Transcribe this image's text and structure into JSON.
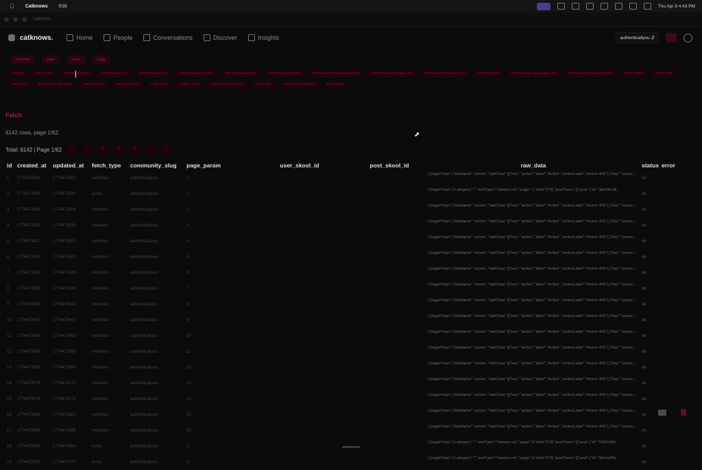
{
  "menubar": {
    "apple_icon": "apple-icon",
    "app_name": "Catknows",
    "menu": [
      "Edit"
    ],
    "clock": "Thu Apr 9 4:43 PM"
  },
  "window": {
    "title": "catknows"
  },
  "nav": {
    "brand": "catknows.",
    "items": [
      {
        "label": "Home",
        "icon": "home-icon"
      },
      {
        "label": "People",
        "icon": "people-icon"
      },
      {
        "label": "Conversations",
        "icon": "chat-icon"
      },
      {
        "label": "Discover",
        "icon": "compass-icon"
      },
      {
        "label": "Insights",
        "icon": "chart-icon"
      }
    ],
    "community_select": "authenticallyou",
    "settings_icon": "gear-icon"
  },
  "tabs": [
    "Fetched",
    "Data",
    "Lead",
    "Logs"
  ],
  "chips": [
    "Fetcher",
    "FETCH 62",
    "fetchMembers 62",
    "fetchMembers 62",
    "fetchPostsRaw 132",
    "fetchComments 12050",
    "fetchCommunities 60",
    "fetchMessages 10000",
    "fetchMembersCommunities 100",
    "fetchMembershipStatus 100",
    "fetchMembersWithJoin 100",
    "fetchPosts 200",
    "fetchMembersAggregation 100",
    "fetchMembersCommunity 200",
    "Fetch 15000",
    "Fetch 1000",
    "fetch 600",
    "fetchCommunity 10000",
    "fetchLast 100",
    "fetchUsers 100",
    "Fetch 1000",
    "Profile 10000",
    "fetchMembership 100",
    "Fetch 1000",
    "fetchMembersWith 1",
    "fetch 10000"
  ],
  "section_title": "Fetch",
  "row_count": "6142 rows, page 1/62",
  "pager": {
    "label": "Total: 6142 | Page 1/62",
    "buttons": [
      "«",
      "‹",
      "1",
      "2",
      "3",
      "›",
      "»"
    ]
  },
  "table": {
    "columns": [
      "id",
      "created_at",
      "updated_at",
      "fetch_type",
      "community_slug",
      "page_param",
      "user_skool_id",
      "post_skool_id",
      "raw_data",
      "status",
      "error"
    ],
    "rows": [
      [
        "1",
        "1774473582",
        "1774473582",
        "members",
        "authenticallyou",
        "1",
        "",
        "",
        "{\"pageProps\":{\"tabName\":\"active\",\"tabChips\":[{\"key\":\"active\",\"label\":\"Active\",\"activeLabel\":\"Active 456\"},{\"key\":\"cance...",
        "ok",
        ""
      ],
      [
        "2",
        "1774473590",
        "1774473590",
        "posts",
        "authenticallyou",
        "1",
        "",
        "",
        "{\"pageProps\":{\"category\":\"\",\"sortType\":\"newest-cm\",\"page\":1,\"total\":578,\"postTrees\":[{\"post\":{\"id\":\"abc66c48...",
        "ok",
        ""
      ],
      [
        "3",
        "1774473608",
        "1774473608",
        "members",
        "authenticallyou",
        "2",
        "",
        "",
        "{\"pageProps\":{\"tabName\":\"active\",\"tabChips\":[{\"key\":\"active\",\"label\":\"Active\",\"activeLabel\":\"Active 456\"},{\"key\":\"cance...",
        "ok",
        ""
      ],
      [
        "4",
        "1774473615",
        "1774473615",
        "members",
        "authenticallyou",
        "3",
        "",
        "",
        "{\"pageProps\":{\"tabName\":\"active\",\"tabChips\":[{\"key\":\"active\",\"label\":\"Active\",\"activeLabel\":\"Active 456\"},{\"key\":\"cance...",
        "ok",
        ""
      ],
      [
        "5",
        "1774473621",
        "1774473621",
        "members",
        "authenticallyou",
        "4",
        "",
        "",
        "{\"pageProps\":{\"tabName\":\"active\",\"tabChips\":[{\"key\":\"active\",\"label\":\"Active\",\"activeLabel\":\"Active 456\"},{\"key\":\"cance...",
        "ok",
        ""
      ],
      [
        "6",
        "1774473625",
        "1774473625",
        "members",
        "authenticallyou",
        "5",
        "",
        "",
        "{\"pageProps\":{\"tabName\":\"active\",\"tabChips\":[{\"key\":\"active\",\"label\":\"Active\",\"activeLabel\":\"Active 456\"},{\"key\":\"cance...",
        "ok",
        ""
      ],
      [
        "7",
        "1774473635",
        "1774473635",
        "members",
        "authenticallyou",
        "6",
        "",
        "",
        "{\"pageProps\":{\"tabName\":\"active\",\"tabChips\":[{\"key\":\"active\",\"label\":\"Active\",\"activeLabel\":\"Active 456\"},{\"key\":\"cance...",
        "ok",
        ""
      ],
      [
        "8",
        "1774473639",
        "1774473639",
        "members",
        "authenticallyou",
        "7",
        "",
        "",
        "{\"pageProps\":{\"tabName\":\"active\",\"tabChips\":[{\"key\":\"active\",\"label\":\"Active\",\"activeLabel\":\"Active 456\"},{\"key\":\"cance...",
        "ok",
        ""
      ],
      [
        "9",
        "1774473642",
        "1774473642",
        "members",
        "authenticallyou",
        "8",
        "",
        "",
        "{\"pageProps\":{\"tabName\":\"active\",\"tabChips\":[{\"key\":\"active\",\"label\":\"Active\",\"activeLabel\":\"Active 456\"},{\"key\":\"cance...",
        "ok",
        ""
      ],
      [
        "10",
        "1774473647",
        "1774473647",
        "members",
        "authenticallyou",
        "9",
        "",
        "",
        "{\"pageProps\":{\"tabName\":\"active\",\"tabChips\":[{\"key\":\"active\",\"label\":\"Active\",\"activeLabel\":\"Active 456\"},{\"key\":\"cance...",
        "ok",
        ""
      ],
      [
        "11",
        "1774473653",
        "1774473653",
        "members",
        "authenticallyou",
        "10",
        "",
        "",
        "{\"pageProps\":{\"tabName\":\"active\",\"tabChips\":[{\"key\":\"active\",\"label\":\"Active\",\"activeLabel\":\"Active 456\"},{\"key\":\"cance...",
        "ok",
        ""
      ],
      [
        "12",
        "1774473659",
        "1774473659",
        "members",
        "authenticallyou",
        "11",
        "",
        "",
        "{\"pageProps\":{\"tabName\":\"active\",\"tabChips\":[{\"key\":\"active\",\"label\":\"Active\",\"activeLabel\":\"Active 456\"},{\"key\":\"cance...",
        "ok",
        ""
      ],
      [
        "13",
        "1774473665",
        "1774473665",
        "members",
        "authenticallyou",
        "12",
        "",
        "",
        "{\"pageProps\":{\"tabName\":\"active\",\"tabChips\":[{\"key\":\"active\",\"label\":\"Active\",\"activeLabel\":\"Active 456\"},{\"key\":\"cance...",
        "ok",
        ""
      ],
      [
        "14",
        "1774473670",
        "1774473670",
        "members",
        "authenticallyou",
        "13",
        "",
        "",
        "{\"pageProps\":{\"tabName\":\"active\",\"tabChips\":[{\"key\":\"active\",\"label\":\"Active\",\"activeLabel\":\"Active 456\"},{\"key\":\"cance...",
        "ok",
        ""
      ],
      [
        "15",
        "1774473676",
        "1774473676",
        "members",
        "authenticallyou",
        "14",
        "",
        "",
        "{\"pageProps\":{\"tabName\":\"active\",\"tabChips\":[{\"key\":\"active\",\"label\":\"Active\",\"activeLabel\":\"Active 456\"},{\"key\":\"cance...",
        "ok",
        ""
      ],
      [
        "16",
        "1774473683",
        "1774473683",
        "members",
        "authenticallyou",
        "15",
        "",
        "",
        "{\"pageProps\":{\"tabName\":\"active\",\"tabChips\":[{\"key\":\"active\",\"label\":\"Active\",\"activeLabel\":\"Active 456\"},{\"key\":\"cance...",
        "ok",
        ""
      ],
      [
        "17",
        "1774473688",
        "1774473688",
        "members",
        "authenticallyou",
        "16",
        "",
        "",
        "{\"pageProps\":{\"tabName\":\"active\",\"tabChips\":[{\"key\":\"active\",\"label\":\"Active\",\"activeLabel\":\"Active 456\"},{\"key\":\"cance...",
        "ok",
        ""
      ],
      [
        "18",
        "1774473694",
        "1774473694",
        "posts",
        "authenticallyou",
        "2",
        "",
        "",
        "{\"pageProps\":{\"category\":\"\",\"sortType\":\"newest-cm\",\"page\":2,\"total\":578,\"postTrees\":[{\"post\":{\"id\":\"f189c4b0...",
        "ok",
        ""
      ],
      [
        "19",
        "1774473700",
        "1774473700",
        "posts",
        "authenticallyou",
        "3",
        "",
        "",
        "{\"pageProps\":{\"category\":\"\",\"sortType\":\"newest-cm\",\"page\":3,\"total\":578,\"postTrees\":[{\"post\":{\"id\":\"0bcbef06...",
        "ok",
        ""
      ]
    ]
  }
}
